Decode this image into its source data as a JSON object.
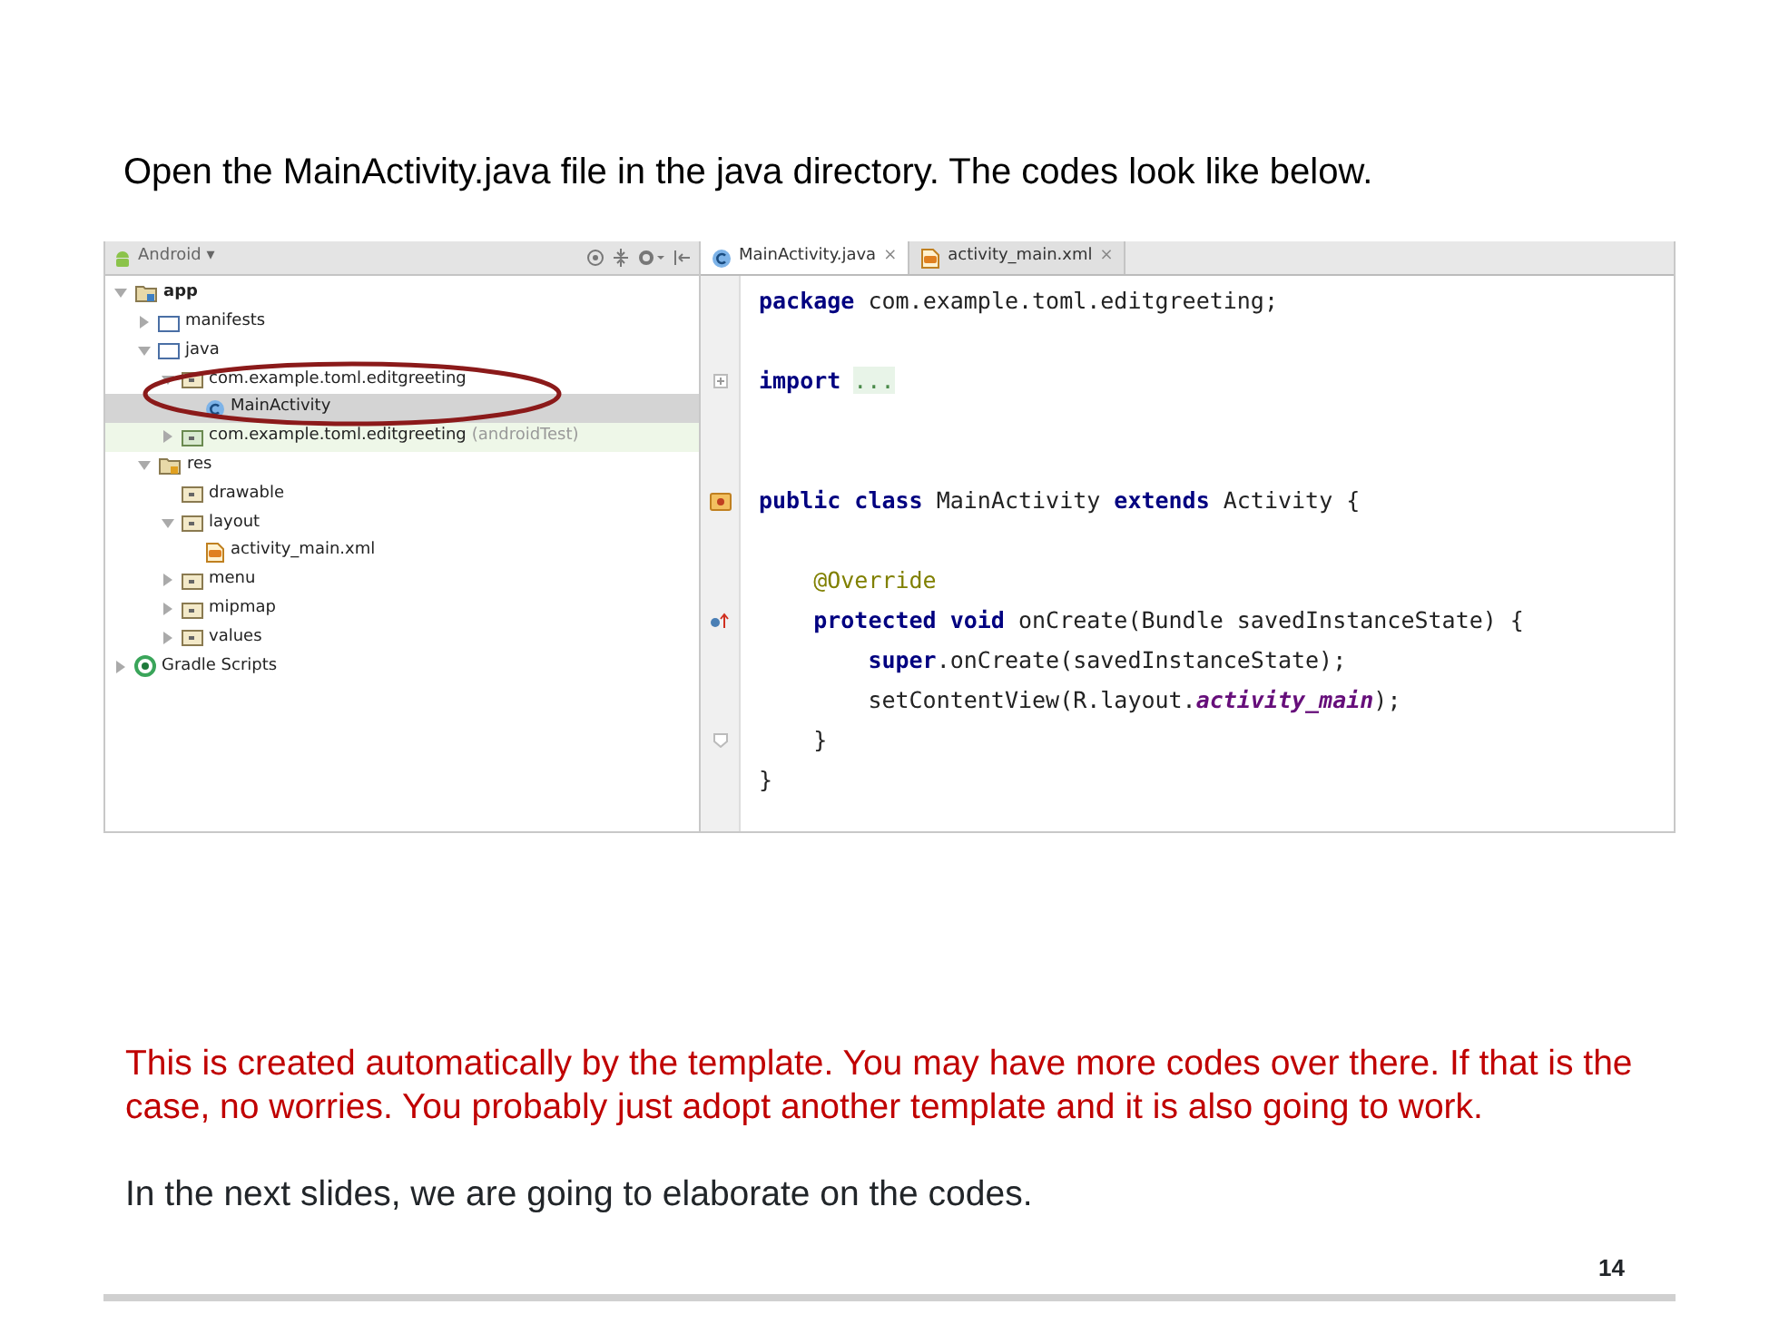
{
  "heading": "Open the MainActivity.java  file in the java directory. The codes look like below.",
  "ide": {
    "view_selector": {
      "label": "Android",
      "caret": "▾"
    },
    "tree": [
      {
        "label": "app",
        "kind": "module",
        "expanded": true,
        "selected": false,
        "children": [
          {
            "label": "manifests",
            "kind": "folder",
            "expanded": false,
            "selected": false
          },
          {
            "label": "java",
            "kind": "folder",
            "expanded": true,
            "selected": false,
            "children": [
              {
                "label": "com.example.toml.editgreeting",
                "kind": "package",
                "expanded": true,
                "selected": false,
                "children": [
                  {
                    "label": "MainActivity",
                    "kind": "class",
                    "selected": true
                  }
                ]
              },
              {
                "label": "com.example.toml.editgreeting",
                "suffix": "(androidTest)",
                "kind": "test-package",
                "expanded": false,
                "selected": false
              }
            ]
          },
          {
            "label": "res",
            "kind": "res",
            "expanded": true,
            "selected": false,
            "children": [
              {
                "label": "drawable",
                "kind": "package",
                "selected": false
              },
              {
                "label": "layout",
                "kind": "package",
                "expanded": true,
                "selected": false,
                "children": [
                  {
                    "label": "activity_main.xml",
                    "kind": "xml",
                    "selected": false
                  }
                ]
              },
              {
                "label": "menu",
                "kind": "package",
                "expanded": false,
                "selected": false
              },
              {
                "label": "mipmap",
                "kind": "package",
                "expanded": false,
                "selected": false
              },
              {
                "label": "values",
                "kind": "package",
                "expanded": false,
                "selected": false
              }
            ]
          }
        ]
      },
      {
        "label": "Gradle Scripts",
        "kind": "gradle",
        "expanded": false,
        "selected": false
      }
    ],
    "tabs": [
      {
        "label": "MainActivity.java",
        "kind": "class",
        "selected": true,
        "close": "×"
      },
      {
        "label": "activity_main.xml",
        "kind": "xml",
        "selected": false,
        "close": "×"
      }
    ],
    "code": [
      {
        "kind": "code",
        "tokens": [
          {
            "text": "package",
            "kind": "keyword"
          },
          {
            "text": " com.example.toml.editgreeting;",
            "kind": "plain"
          }
        ]
      },
      {
        "kind": "blank"
      },
      {
        "kind": "fold-start",
        "tokens": [
          {
            "text": "import",
            "kind": "keyword"
          },
          {
            "text": "...",
            "kind": "folded"
          }
        ]
      },
      {
        "kind": "blank"
      },
      {
        "kind": "blank"
      },
      {
        "kind": "class-declaration",
        "tokens": [
          {
            "text": "public class",
            "kind": "keyword"
          },
          {
            "text": " MainActivity ",
            "kind": "plain"
          },
          {
            "text": "extends",
            "kind": "keyword"
          },
          {
            "text": " Activity {",
            "kind": "plain"
          }
        ]
      },
      {
        "kind": "blank"
      },
      {
        "kind": "code",
        "tokens": [
          {
            "text": "    @Override",
            "kind": "annotation"
          }
        ]
      },
      {
        "kind": "method-override",
        "tokens": [
          {
            "text": "    protected void",
            "kind": "keyword"
          },
          {
            "text": " onCreate(Bundle savedInstanceState) {",
            "kind": "plain"
          }
        ]
      },
      {
        "kind": "code",
        "tokens": [
          {
            "text": "        super",
            "kind": "keyword"
          },
          {
            "text": ".onCreate(savedInstanceState);",
            "kind": "plain"
          }
        ]
      },
      {
        "kind": "code",
        "tokens": [
          {
            "text": "        setContentView(R.layout.",
            "kind": "plain"
          },
          {
            "text": "activity_main",
            "kind": "field"
          },
          {
            "text": ");",
            "kind": "plain"
          }
        ]
      },
      {
        "kind": "fold-end",
        "tokens": [
          {
            "text": "    }",
            "kind": "plain"
          }
        ]
      },
      {
        "kind": "code",
        "tokens": [
          {
            "text": "}",
            "kind": "plain"
          }
        ]
      }
    ]
  },
  "notes": [
    "This is created automatically by the template. You may have more codes over there. If that is the case, no worries. You probably just adopt another template and it is also going to work.",
    "In the next slides, we are going to elaborate on the codes."
  ],
  "page_number": "14"
}
